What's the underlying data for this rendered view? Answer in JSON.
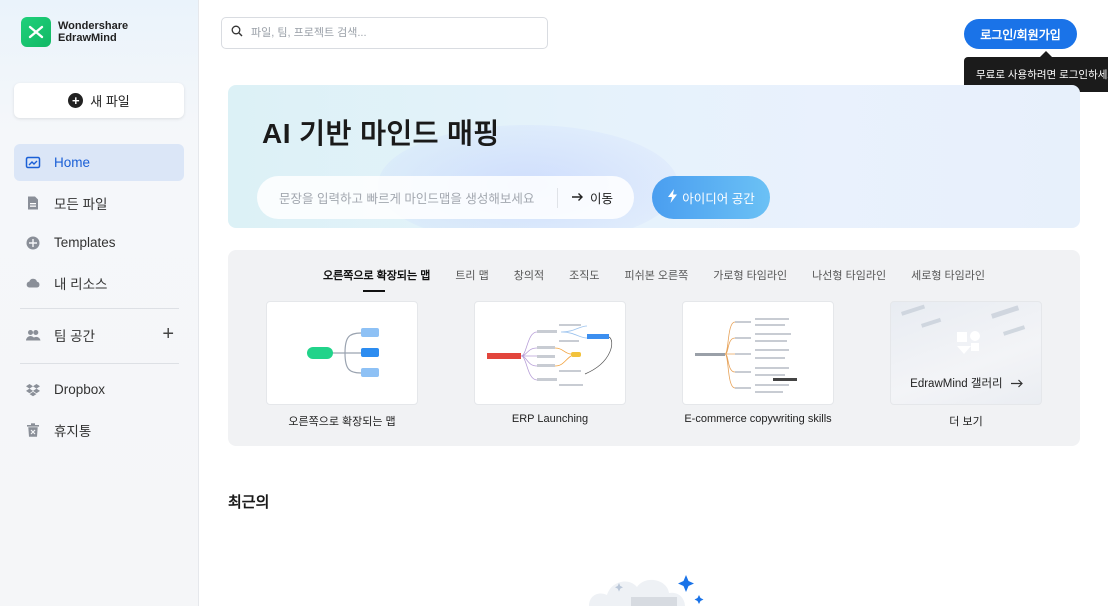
{
  "brand": {
    "line1": "Wondershare",
    "line2": "EdrawMind"
  },
  "sidebar": {
    "new_file": "새 파일",
    "items": [
      {
        "label": "Home",
        "icon": "home-icon"
      },
      {
        "label": "모든 파일",
        "icon": "file-icon"
      },
      {
        "label": "Templates",
        "icon": "templates-icon"
      },
      {
        "label": "내 리소스",
        "icon": "cloud-icon"
      }
    ],
    "team": {
      "label": "팀 공간",
      "icon": "team-icon"
    },
    "lower": [
      {
        "label": "Dropbox",
        "icon": "dropbox-icon"
      },
      {
        "label": "휴지통",
        "icon": "trash-icon"
      }
    ]
  },
  "search": {
    "placeholder": "파일, 팀, 프로젝트 검색..."
  },
  "header": {
    "login_label": "로그인/회원가입",
    "tooltip": "무료로 사용하려면 로그인하세요"
  },
  "hero": {
    "title": "AI 기반 마인드 매핑",
    "input_placeholder": "문장을 입력하고 빠르게 마인드맵을 생성해보세요",
    "go_label": "이동",
    "idea_label": "아이디어 공간"
  },
  "templates": {
    "tabs": [
      "오른쪽으로 확장되는 맵",
      "트리 맵",
      "창의적",
      "조직도",
      "피쉬본 오른쪽",
      "가로형 타임라인",
      "나선형 타임라인",
      "세로형 타임라인"
    ],
    "cards": [
      {
        "label": "오른쪽으로 확장되는 맵"
      },
      {
        "label": "ERP Launching"
      },
      {
        "label": "E-commerce copywriting skills"
      },
      {
        "label": "더 보기",
        "gallery_text": "EdrawMind 갤러리"
      }
    ]
  },
  "recent": {
    "title": "최근의"
  },
  "colors": {
    "accent": "#1a73e8",
    "active_nav": "#dbe6f7",
    "brand_green": "#1fd07a"
  }
}
